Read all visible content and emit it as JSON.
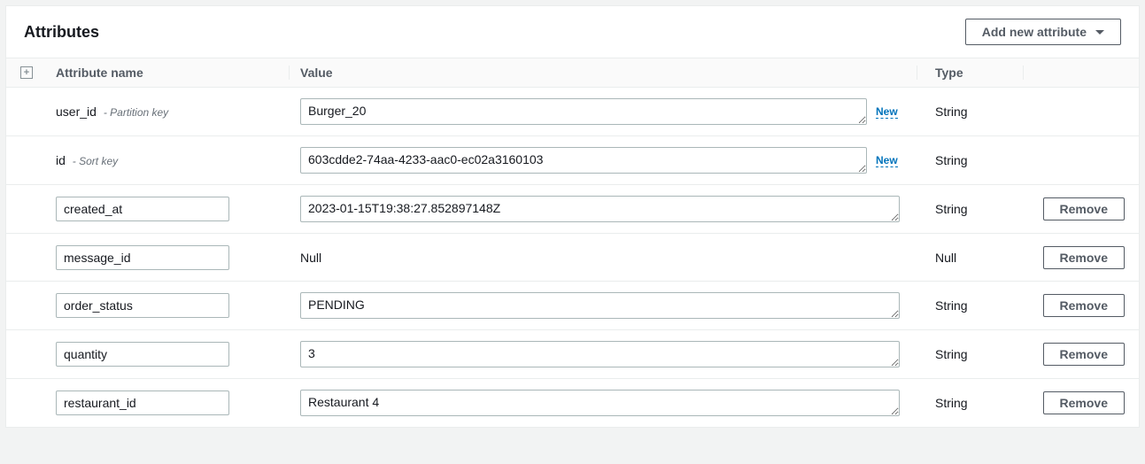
{
  "panel": {
    "title": "Attributes",
    "add_button_label": "Add new attribute"
  },
  "columns": {
    "name": "Attribute name",
    "value": "Value",
    "type": "Type"
  },
  "labels": {
    "new_indicator": "New",
    "remove_button": "Remove",
    "null_value": "Null",
    "partition_key_hint": "- Partition key",
    "sort_key_hint": "- Sort key"
  },
  "attributes": [
    {
      "name": "user_id",
      "key_role": "partition",
      "value": "Burger_20",
      "type": "String",
      "is_new": true,
      "removable": false,
      "name_editable": false,
      "value_is_null": false
    },
    {
      "name": "id",
      "key_role": "sort",
      "value": "603cdde2-74aa-4233-aac0-ec02a3160103",
      "type": "String",
      "is_new": true,
      "removable": false,
      "name_editable": false,
      "value_is_null": false
    },
    {
      "name": "created_at",
      "key_role": null,
      "value": "2023-01-15T19:38:27.852897148Z",
      "type": "String",
      "is_new": false,
      "removable": true,
      "name_editable": true,
      "value_is_null": false
    },
    {
      "name": "message_id",
      "key_role": null,
      "value": null,
      "type": "Null",
      "is_new": false,
      "removable": true,
      "name_editable": true,
      "value_is_null": true
    },
    {
      "name": "order_status",
      "key_role": null,
      "value": "PENDING",
      "type": "String",
      "is_new": false,
      "removable": true,
      "name_editable": true,
      "value_is_null": false
    },
    {
      "name": "quantity",
      "key_role": null,
      "value": "3",
      "type": "String",
      "is_new": false,
      "removable": true,
      "name_editable": true,
      "value_is_null": false
    },
    {
      "name": "restaurant_id",
      "key_role": null,
      "value": "Restaurant 4",
      "type": "String",
      "is_new": false,
      "removable": true,
      "name_editable": true,
      "value_is_null": false
    }
  ]
}
